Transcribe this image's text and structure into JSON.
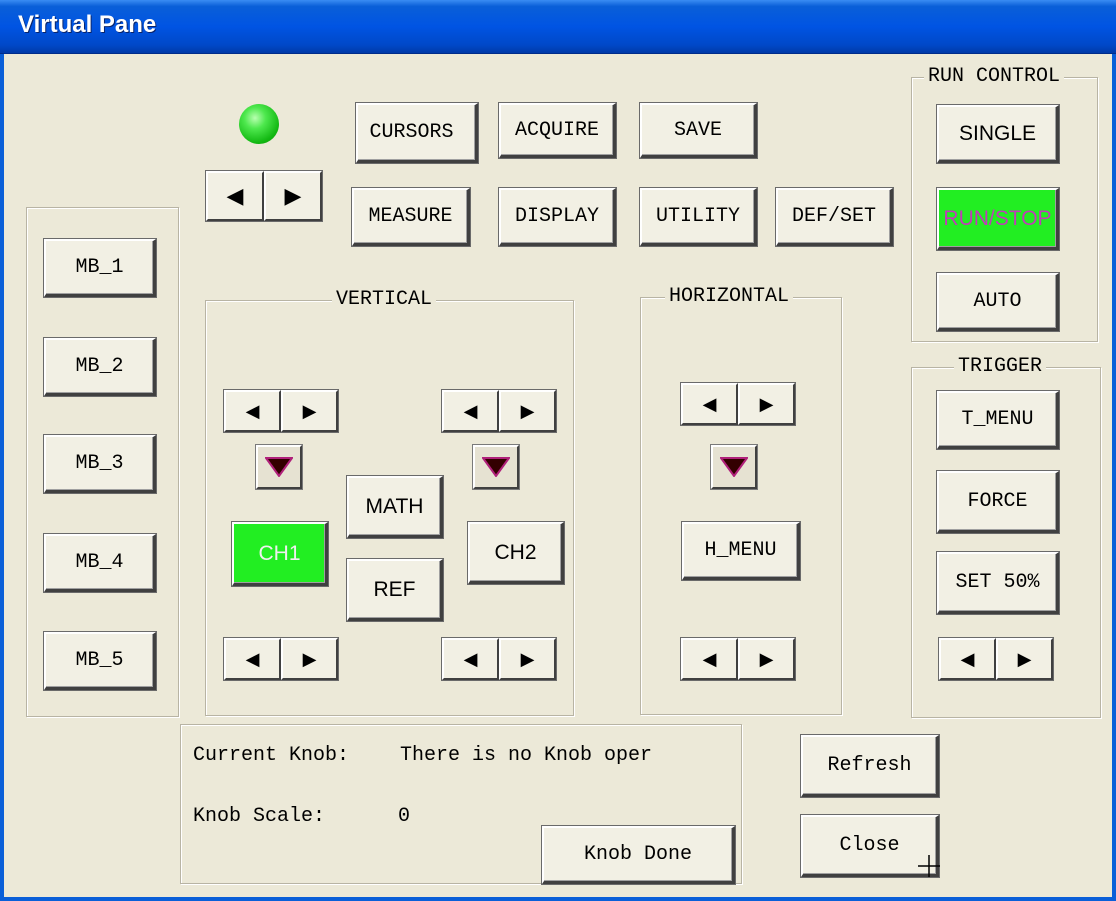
{
  "window": {
    "title": "Virtual Pane"
  },
  "menu_buttons": [
    "CURSORS",
    "ACQUIRE",
    "SAVE",
    "MEASURE",
    "DISPLAY",
    "UTILITY",
    "DEF/SET"
  ],
  "menu_buttons_display": [
    "CURSORS"
  ],
  "mb_buttons": [
    "MB_1",
    "MB_2",
    "MB_3",
    "MB_4",
    "MB_5"
  ],
  "run_control": {
    "title": "RUN CONTROL",
    "single": "SINGLE",
    "run_stop": "RUN/STOP",
    "auto": "AUTO"
  },
  "vertical": {
    "title": "VERTICAL",
    "math": "MATH",
    "ref": "REF",
    "ch1": "CH1",
    "ch2": "CH2"
  },
  "horizontal": {
    "title": "HORIZONTAL",
    "h_menu": "H_MENU"
  },
  "trigger": {
    "title": "TRIGGER",
    "t_menu": "T_MENU",
    "force": "FORCE",
    "set50": "SET 50%"
  },
  "knob": {
    "current_label": "Current Knob:",
    "current_value": "There is no Knob oper",
    "scale_label": "Knob Scale:",
    "scale_value": "0",
    "done": "Knob Done"
  },
  "actions": {
    "refresh": "Refresh",
    "close": "Close"
  },
  "arrow_glyphs": {
    "left": "◀",
    "right": "▶"
  },
  "colors": {
    "active_green": "#22ee22",
    "title_blue": "#0054e3",
    "led_green": "#12b812"
  }
}
